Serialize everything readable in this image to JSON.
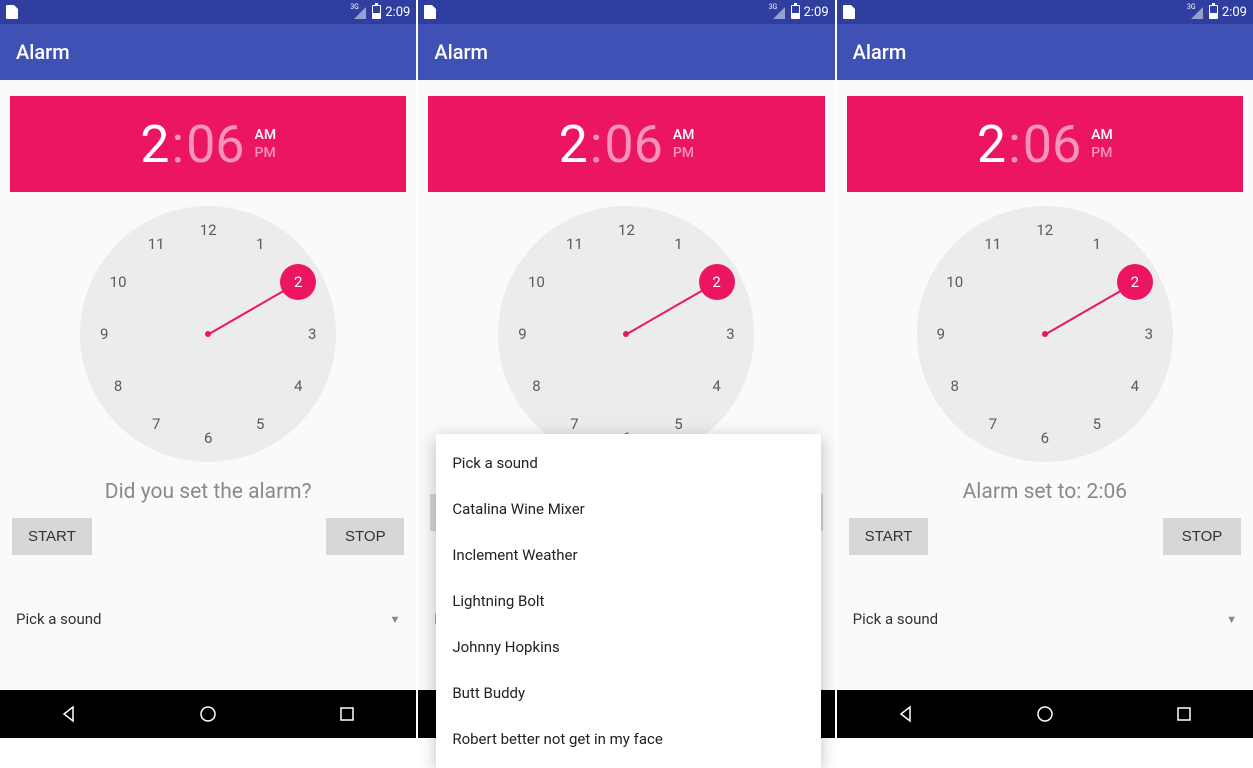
{
  "status": {
    "time": "2:09"
  },
  "appbar": {
    "title": "Alarm"
  },
  "time_picker": {
    "hour": "2",
    "minute": "06",
    "am_label": "AM",
    "pm_label": "PM",
    "selected_hour": 2,
    "clock_numbers": [
      "12",
      "1",
      "2",
      "3",
      "4",
      "5",
      "6",
      "7",
      "8",
      "9",
      "10",
      "11"
    ]
  },
  "screens": [
    {
      "prompt": "Did you set the alarm?",
      "spinner_value": "Pick a sound",
      "popup_open": false
    },
    {
      "prompt": "",
      "spinner_value": "Pick a sound",
      "popup_open": true
    },
    {
      "prompt": "Alarm set to: 2:06",
      "spinner_value": "Pick a sound",
      "popup_open": false
    }
  ],
  "buttons": {
    "start": "START",
    "stop": "STOP"
  },
  "sound_options": [
    "Pick a sound",
    "Catalina Wine Mixer",
    "Inclement Weather",
    "Lightning Bolt",
    "Johnny Hopkins",
    "Butt Buddy",
    "Robert better not get in my face"
  ]
}
